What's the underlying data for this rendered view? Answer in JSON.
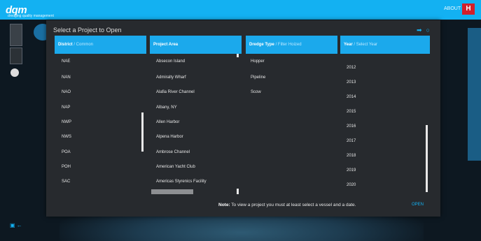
{
  "app": {
    "logo_text": "dqm",
    "logo_sub": "dredging quality management",
    "about": "ABOUT",
    "usace_mark": "H"
  },
  "dialog": {
    "title": "Select a Project to Open",
    "columns": [
      {
        "label": "District",
        "hint": "/ Common"
      },
      {
        "label": "Project Area",
        "hint": ""
      },
      {
        "label": "Dredge Type",
        "hint": "/ Filter Hoized"
      },
      {
        "label": "Year",
        "hint": "/ Select Year"
      }
    ],
    "districts": [
      "NAE",
      "NAN",
      "NAO",
      "NAP",
      "NWP",
      "NWS",
      "POA",
      "POH",
      "SAC"
    ],
    "projects": [
      "Absecon Island",
      "Admiralty Wharf",
      "Alafia River Channel",
      "Albany, NY",
      "Allen Harbor",
      "Alpena Harbor",
      "Ambrose Channel",
      "American Yacht Club",
      "Americas Styrenics Facility"
    ],
    "dredge_types": [
      "Hopper",
      "Pipeline",
      "Scow"
    ],
    "years": [
      "2012",
      "2013",
      "2014",
      "2015",
      "2016",
      "2017",
      "2018",
      "2019",
      "2020"
    ],
    "note_label": "Note:",
    "note_text": " To view a project you must at least select a vessel and a date.",
    "open_button": "OPEN"
  }
}
